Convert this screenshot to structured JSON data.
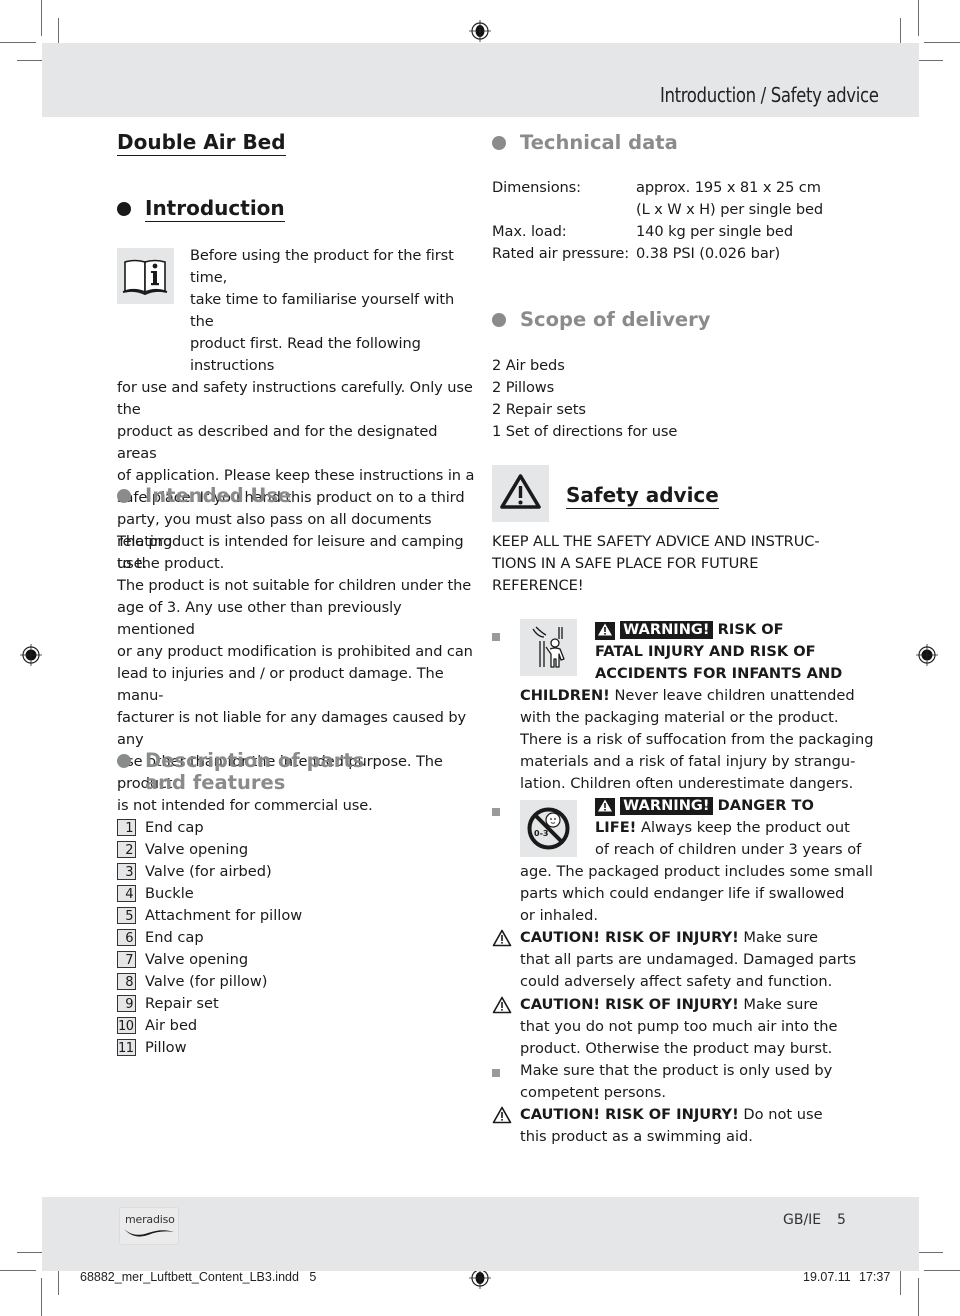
{
  "header": {
    "section_title": "Introduction / Safety advice"
  },
  "page_title": "Double Air Bed",
  "introduction": {
    "heading": "Introduction",
    "icon": "manual-info-icon",
    "lines": [
      "Before using the product for the first time,",
      "take time to familiarise yourself with the",
      "product first. Read the following instructions",
      "for use and safety instructions carefully. Only use the",
      "product as described and for the designated areas",
      "of application. Please keep these instructions in a",
      "safe place. If you hand this product on to a third",
      "party, you must also pass on all documents relating",
      "to the product."
    ]
  },
  "intended_use": {
    "heading": "Intended Use",
    "lines": [
      "The product is intended for leisure and camping use.",
      "The product is not suitable for children under the",
      "age of 3. Any use other than previously mentioned",
      "or any product modification is prohibited and can",
      "lead to injuries and / or product damage. The manu-",
      "facturer is not liable for any damages caused by any",
      "use other than for the intended purpose. The product",
      "is not intended for commercial use."
    ]
  },
  "parts": {
    "heading_line1": "Description of parts",
    "heading_line2": "and features",
    "items": [
      {
        "num": "1",
        "label": "End cap"
      },
      {
        "num": "2",
        "label": "Valve opening"
      },
      {
        "num": "3",
        "label": "Valve (for airbed)"
      },
      {
        "num": "4",
        "label": "Buckle"
      },
      {
        "num": "5",
        "label": "Attachment for pillow"
      },
      {
        "num": "6",
        "label": "End cap"
      },
      {
        "num": "7",
        "label": "Valve opening"
      },
      {
        "num": "8",
        "label": "Valve (for pillow)"
      },
      {
        "num": "9",
        "label": "Repair set"
      },
      {
        "num": "10",
        "label": "Air bed"
      },
      {
        "num": "11",
        "label": "Pillow"
      }
    ]
  },
  "technical_data": {
    "heading": "Technical data",
    "rows": [
      {
        "label": "Dimensions:",
        "value": "approx. 195 x 81 x 25 cm"
      },
      {
        "label": "",
        "value": "(L x W x H) per single bed"
      },
      {
        "label": "Max. load:",
        "value": "140 kg per single bed"
      },
      {
        "label": "Rated air pressure:",
        "value": "0.38 PSI (0.026 bar)"
      }
    ]
  },
  "scope_of_delivery": {
    "heading": "Scope of delivery",
    "items": [
      "2 Air beds",
      "2 Pillows",
      "2 Repair sets",
      "1 Set of directions for use"
    ]
  },
  "safety": {
    "heading": "Safety advice",
    "keep_lines": [
      "KEEP ALL THE SAFETY ADVICE AND INSTRUC-",
      "TIONS IN A SAFE PLACE FOR FUTURE",
      "REFERENCE!"
    ],
    "warning1": {
      "tag": "WARNING!",
      "head_line1": "RISK OF",
      "head_line2": "FATAL INJURY AND RISK OF",
      "head_line3": "ACCIDENTS FOR INFANTS AND",
      "head_line4": "CHILDREN!",
      "line4_rest": " Never leave children unattended",
      "lines": [
        "with the packaging material or the product.",
        "There is a risk of suffocation from the packaging",
        "materials and a risk of fatal injury by strangu-",
        "lation. Children often underestimate dangers."
      ]
    },
    "warning2": {
      "tag": "WARNING!",
      "head_line1": "DANGER TO",
      "head_line2": "LIFE!",
      "line2_rest": " Always keep the product out",
      "line3": "of reach of children under 3 years of",
      "lines": [
        "age. The packaged product includes some small",
        "parts which could endanger life if swallowed",
        "or inhaled."
      ],
      "age_label": "0-3"
    },
    "caution1": {
      "bold": "CAUTION! RISK OF INJURY!",
      "rest": " Make sure",
      "lines": [
        "that all parts are undamaged. Damaged parts",
        "could adversely affect safety and function."
      ]
    },
    "caution2": {
      "bold": "CAUTION! RISK OF INJURY!",
      "rest": " Make sure",
      "lines": [
        "that you do not pump too much air into the",
        "product. Otherwise the product may burst."
      ]
    },
    "note": {
      "lines": [
        "Make sure that the product is only used by",
        "competent persons."
      ]
    },
    "caution3": {
      "bold": "CAUTION! RISK OF INJURY!",
      "rest": " Do not use",
      "lines": [
        "this product as a swimming aid."
      ]
    }
  },
  "footer": {
    "brand": "meradiso",
    "locale": "GB/IE",
    "page_number": "5",
    "slug_file": "68882_mer_Luftbett_Content_LB3.indd   5",
    "slug_date": "19.07.11",
    "slug_time": "17:37"
  },
  "colors": {
    "band_gray": "#e5e6e7",
    "heading_gray": "#8a8b8c",
    "text": "#1a1a1a"
  }
}
